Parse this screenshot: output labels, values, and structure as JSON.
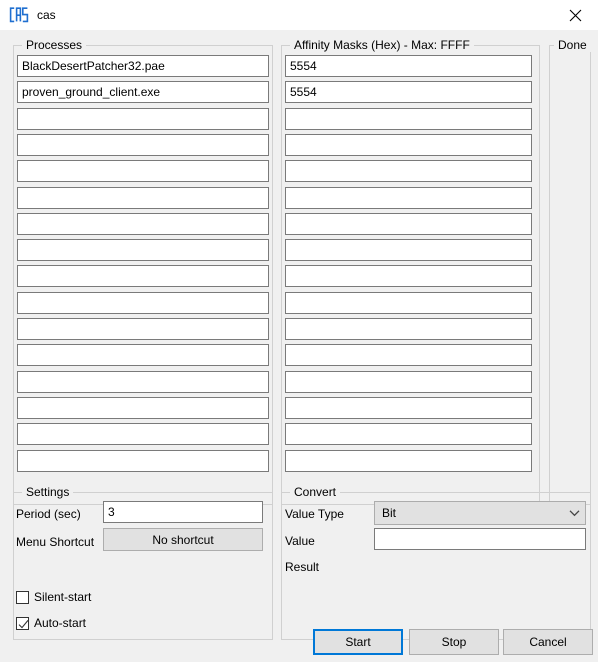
{
  "window": {
    "title": "cas",
    "icon": "cas-logo-icon",
    "close_icon": "close-icon",
    "accent_color": "#0078d7",
    "background_color": "#f0f0f0"
  },
  "processes_group": {
    "title": "Processes",
    "placeholder": "",
    "rows": [
      "BlackDesertPatcher32.pae",
      "proven_ground_client.exe",
      "",
      "",
      "",
      "",
      "",
      "",
      "",
      "",
      "",
      "",
      "",
      "",
      "",
      ""
    ]
  },
  "affinity_group": {
    "title": "Affinity Masks (Hex) - Max: FFFF",
    "max_value": "FFFF",
    "placeholder": "",
    "rows": [
      "5554",
      "5554",
      "",
      "",
      "",
      "",
      "",
      "",
      "",
      "",
      "",
      "",
      "",
      "",
      "",
      ""
    ]
  },
  "done_group": {
    "title": "Done",
    "rows": [
      "",
      "",
      "",
      "",
      "",
      "",
      "",
      "",
      "",
      "",
      "",
      "",
      "",
      "",
      "",
      ""
    ]
  },
  "settings_group": {
    "title": "Settings",
    "period_label": "Period (sec)",
    "period_value": "3",
    "period_placeholder": "",
    "menu_shortcut_label": "Menu Shortcut",
    "menu_shortcut_button": "No shortcut",
    "silent_start_label": "Silent-start",
    "silent_start_checked": false,
    "auto_start_label": "Auto-start",
    "auto_start_checked": true
  },
  "convert_group": {
    "title": "Convert",
    "value_type_label": "Value Type",
    "value_type_selected": "Bit",
    "value_type_icon": "chevron-down-icon",
    "value_label": "Value",
    "value_text": "",
    "value_placeholder": "",
    "result_label": "Result",
    "result_text": ""
  },
  "footer": {
    "start_label": "Start",
    "stop_label": "Stop",
    "cancel_label": "Cancel",
    "focused_button": "Start"
  }
}
